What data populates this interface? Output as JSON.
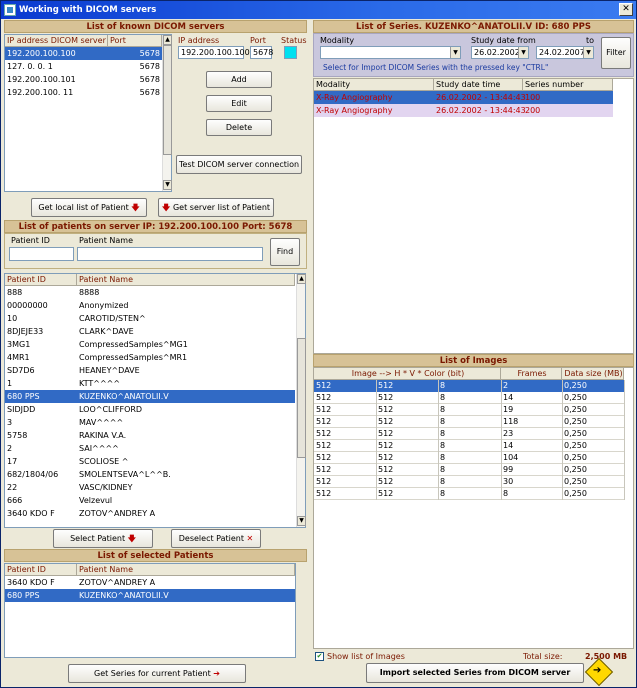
{
  "window": {
    "title": "Working with DICOM servers"
  },
  "servers": {
    "header": "List of known DICOM servers",
    "col_ip": "IP address DICOM server",
    "col_port": "Port",
    "rows": [
      {
        "ip": "192.200.100.100",
        "port": "5678"
      },
      {
        "ip": "127.  0.  0.  1",
        "port": "5678"
      },
      {
        "ip": "192.200.100.101",
        "port": "5678"
      },
      {
        "ip": "192.200.100. 11",
        "port": "5678"
      }
    ],
    "ip_label": "IP address",
    "port_label": "Port",
    "status_label": "Status",
    "ip_value": "192.200.100.100",
    "port_value": "5678",
    "add": "Add",
    "edit": "Edit",
    "delete": "Delete",
    "test": "Test DICOM server connection",
    "local_list": "Get local list of Patient",
    "server_list": "Get server list of Patient",
    "status_color": "#00e0f0"
  },
  "patients": {
    "header": "List of patients on server IP:  192.200.100.100   Port: 5678",
    "id_label": "Patient ID",
    "name_label": "Patient Name",
    "find": "Find",
    "col_id": "Patient ID",
    "col_name": "Patient Name",
    "rows": [
      {
        "id": "888",
        "name": "8888"
      },
      {
        "id": "00000000",
        "name": "Anonymized"
      },
      {
        "id": "10",
        "name": "CAROTID/STEN^"
      },
      {
        "id": "8DJEJE33",
        "name": "CLARK^DAVE"
      },
      {
        "id": "3MG1",
        "name": "CompressedSamples^MG1"
      },
      {
        "id": "4MR1",
        "name": "CompressedSamples^MR1"
      },
      {
        "id": "SD7D6",
        "name": "HEANEY^DAVE"
      },
      {
        "id": "1",
        "name": "KTT^^^^"
      },
      {
        "id": "680  PPS",
        "name": "KUZENKO^ANATOLII.V"
      },
      {
        "id": "SIDJDD",
        "name": "LOO^CLIFFORD"
      },
      {
        "id": "3",
        "name": "MAV^^^^"
      },
      {
        "id": "5758",
        "name": "RAKINA V.A."
      },
      {
        "id": "2",
        "name": "SAI^^^^"
      },
      {
        "id": "17",
        "name": "SCOLIOSE ^"
      },
      {
        "id": "682/1804/06",
        "name": "SMOLENTSEVA^L^^B."
      },
      {
        "id": "22",
        "name": "VASC/KIDNEY"
      },
      {
        "id": "666",
        "name": "Velzevul"
      },
      {
        "id": "3640 KDO F",
        "name": "ZOTOV^ANDREY A"
      }
    ],
    "select": "Select Patient",
    "deselect": "Deselect Patient"
  },
  "selected": {
    "header": "List of selected Patients",
    "col_id": "Patient ID",
    "col_name": "Patient Name",
    "rows": [
      {
        "id": "3640 KDO F",
        "name": "ZOTOV^ANDREY A"
      },
      {
        "id": "680  PPS",
        "name": "KUZENKO^ANATOLII.V"
      }
    ],
    "get_series": "Get Series for current Patient"
  },
  "series": {
    "header": "List of Series.  KUZENKO^ANATOLII.V ID: 680  PPS",
    "modality_label": "Modality",
    "study_date_label": "Study date  from",
    "to_label": "to",
    "modality_value": "",
    "date_from": "26.02.2002",
    "date_to": "24.02.2007",
    "filter": "Filter",
    "hint": "Select for Import DICOM Series with the pressed key \"CTRL\"",
    "col_modality": "Modality",
    "col_date": "Study date time",
    "col_number": "Series number",
    "rows": [
      {
        "modality": "X-Ray Angiography",
        "date": "26.02.2002 - 13:44:43",
        "number": "100"
      },
      {
        "modality": "X-Ray Angiography",
        "date": "26.02.2002 - 13:44:43",
        "number": "200"
      }
    ]
  },
  "images": {
    "header": "List of Images",
    "col_image": "Image  -->  H * V * Color (bit)",
    "col_frames": "Frames",
    "col_size": "Data size (MB)",
    "rows": [
      {
        "h": "512",
        "v": "512",
        "c": "8",
        "f": "2",
        "s": "0,250"
      },
      {
        "h": "512",
        "v": "512",
        "c": "8",
        "f": "14",
        "s": "0,250"
      },
      {
        "h": "512",
        "v": "512",
        "c": "8",
        "f": "19",
        "s": "0,250"
      },
      {
        "h": "512",
        "v": "512",
        "c": "8",
        "f": "118",
        "s": "0,250"
      },
      {
        "h": "512",
        "v": "512",
        "c": "8",
        "f": "23",
        "s": "0,250"
      },
      {
        "h": "512",
        "v": "512",
        "c": "8",
        "f": "14",
        "s": "0,250"
      },
      {
        "h": "512",
        "v": "512",
        "c": "8",
        "f": "104",
        "s": "0,250"
      },
      {
        "h": "512",
        "v": "512",
        "c": "8",
        "f": "99",
        "s": "0,250"
      },
      {
        "h": "512",
        "v": "512",
        "c": "8",
        "f": "30",
        "s": "0,250"
      },
      {
        "h": "512",
        "v": "512",
        "c": "8",
        "f": "8",
        "s": "0,250"
      }
    ],
    "show_label": "Show list of Images",
    "total_label": "Total size:",
    "total_value": "2,500 MB",
    "import": "Import selected Series from DICOM server"
  }
}
